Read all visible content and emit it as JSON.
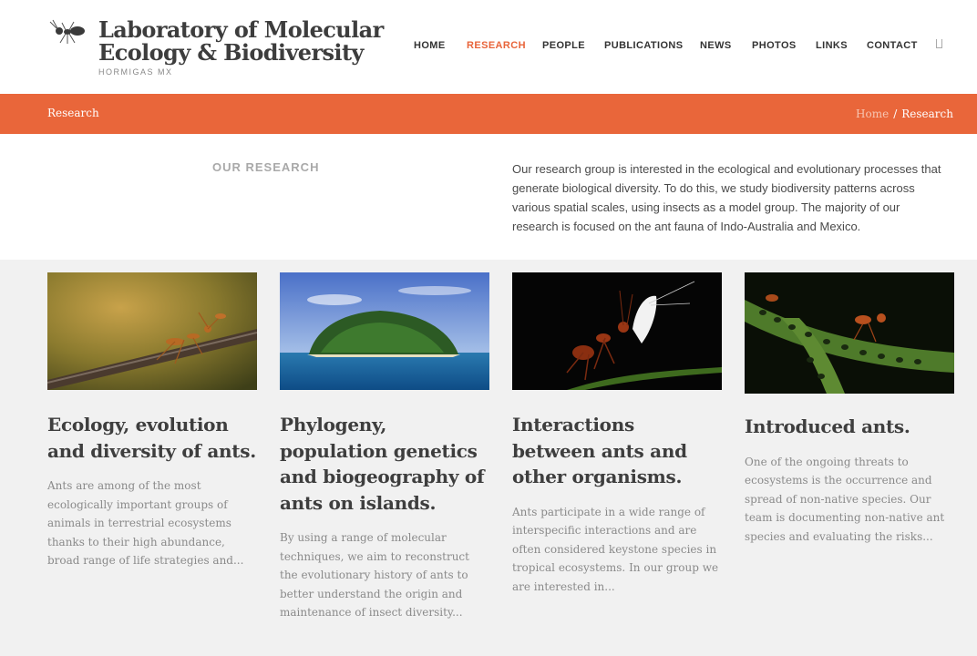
{
  "header": {
    "logo_icon": "ant-logo-icon",
    "title_line1": "Laboratory of Molecular",
    "title_line2": "Ecology & Biodiversity",
    "subtitle": "HORMIGAS MX"
  },
  "nav": {
    "items": [
      {
        "label": "HOME"
      },
      {
        "label": "RESEARCH"
      },
      {
        "label": "PEOPLE"
      },
      {
        "label": "PUBLICATIONS"
      },
      {
        "label": "NEWS"
      },
      {
        "label": "PHOTOS"
      },
      {
        "label": "LINKS"
      },
      {
        "label": "CONTACT"
      }
    ],
    "active": "RESEARCH",
    "search_icon": "search-icon"
  },
  "page_bar": {
    "title": "Research",
    "breadcrumb_home": "Home",
    "breadcrumb_sep": "/",
    "breadcrumb_current": "Research"
  },
  "intro": {
    "heading": "OUR RESEARCH",
    "text": "Our research group is interested in the ecological and evolutionary processes that generate biological diversity. To do this, we study biodiversity patterns across various spatial scales, using insects as a model group. The majority of our research is focused on the ant fauna of Indo-Australia and Mexico."
  },
  "cards": [
    {
      "title": "Ecology, evolution and diversity of ants.",
      "excerpt": "Ants are among of the most ecologically important groups of animals in terrestrial ecosystems thanks to their high abundance, broad range of life strategies and..."
    },
    {
      "title": "Phylogeny, population genetics and biogeography of ants on islands.",
      "excerpt": "By using a range of molecular techniques, we aim to reconstruct the evolutionary history of ants to better understand the origin and maintenance of insect diversity..."
    },
    {
      "title": "Interactions between ants and other organisms.",
      "excerpt": "Ants participate in a wide range of interspecific interactions and are often considered keystone species in tropical ecosystems. In our group we are interested in..."
    },
    {
      "title": "Introduced ants.",
      "excerpt": "One of the ongoing threats to ecosystems is the occurrence and spread of non-native species. Our team is documenting non-native ant species and evaluating the risks..."
    }
  ],
  "colors": {
    "accent": "#e9663a",
    "heading": "#3e3e3e",
    "muted": "#8a8a8a",
    "background": "#f1f1f1"
  }
}
